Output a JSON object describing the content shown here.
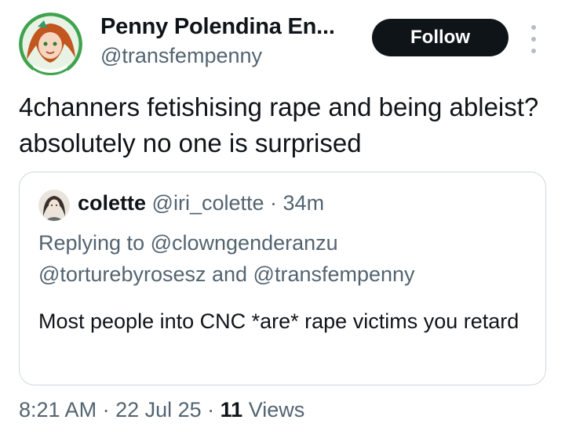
{
  "author": {
    "display_name": "Penny Polendina En...",
    "handle": "@transfempenny"
  },
  "actions": {
    "follow_label": "Follow"
  },
  "tweet": {
    "text": "4channers fetishising  rape and being ableist? absolutely no one is surprised"
  },
  "quote": {
    "name": "colette",
    "handle": "@iri_colette",
    "separator": " · ",
    "time": "34m",
    "replying_prefix": "Replying to ",
    "reply_users": [
      "@clowngenderanzu",
      "@torturebyrosesz",
      "@transfempenny"
    ],
    "reply_and": " and ",
    "text": "Most people into CNC *are* rape victims you retard"
  },
  "footer": {
    "time": "8:21 AM",
    "sep1": " · ",
    "date": "22 Jul 25",
    "sep2": " · ",
    "views_count": "11",
    "views_label": " Views"
  },
  "colors": {
    "primary_text": "#0f1419",
    "secondary_text": "#536471",
    "follow_bg": "#0f1419",
    "border": "#cfd9de"
  },
  "icons": {
    "more": "more-vertical-icon"
  }
}
